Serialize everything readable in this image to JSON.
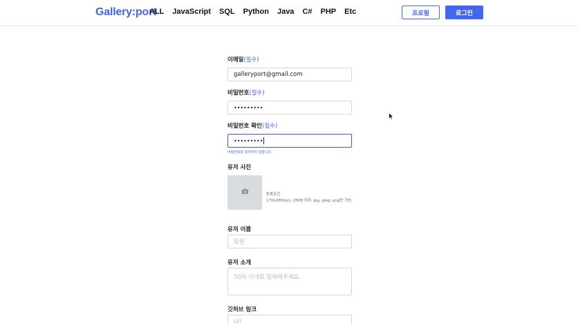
{
  "header": {
    "logo": "Gallery:port",
    "nav": [
      "ALL",
      "JavaScript",
      "SQL",
      "Python",
      "Java",
      "C#",
      "PHP",
      "Etc"
    ],
    "profile_button": "프로필",
    "login_button": "로그인",
    "brand_color": "#4466dd"
  },
  "form": {
    "email": {
      "label": "이메일",
      "required": "(필수)",
      "value": "galleryport@gmail.com"
    },
    "password": {
      "label": "비밀번호",
      "required": "(필수)",
      "value": "•••••••••"
    },
    "password_confirm": {
      "label": "비밀번호 확인",
      "required": "(필수)",
      "value": "•••••••••",
      "error": "비밀번호와 일치하지 않습니다."
    },
    "photo": {
      "label": "유저 사진",
      "icon": "camera-icon",
      "conditions_title": "등록조건",
      "conditions": "170x280(px), 25KB 이하, jpg, jpeg, png만 가능"
    },
    "username": {
      "label": "유저 이름",
      "placeholder": "팀원"
    },
    "bio": {
      "label": "유저 소개",
      "placeholder": "50자 이내로 입력해주세요."
    },
    "github": {
      "label": "깃허브 링크",
      "placeholder": "url"
    }
  }
}
